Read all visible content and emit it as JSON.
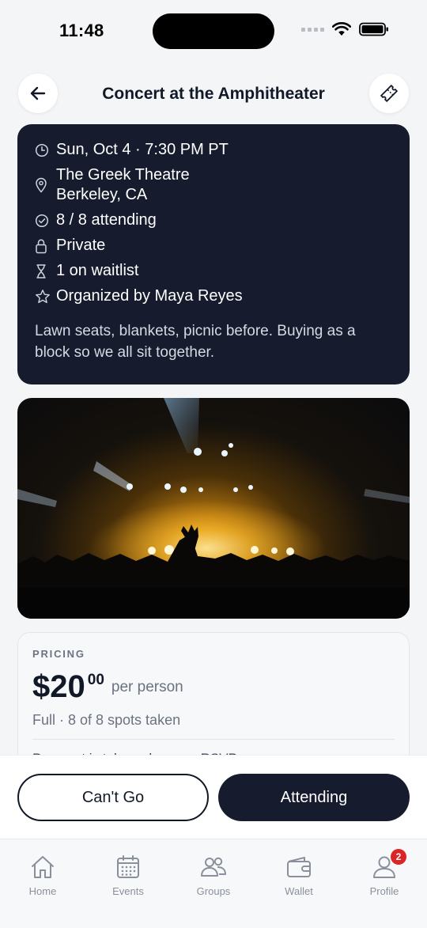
{
  "status_bar": {
    "time": "11:48"
  },
  "header": {
    "title": "Concert at the Amphitheater"
  },
  "event": {
    "rows": [
      {
        "icon": "clock-icon",
        "text": "Sun, Oct 4 · 7:30 PM PT"
      },
      {
        "icon": "location-pin-icon",
        "text": "The Greek Theatre\nBerkeley, CA"
      },
      {
        "icon": "check-circle-icon",
        "text": "8 / 8 attending"
      },
      {
        "icon": "lock-icon",
        "text": "Private"
      },
      {
        "icon": "hourglass-icon",
        "text": "1 on waitlist"
      },
      {
        "icon": "star-icon",
        "text": "Organized by Maya Reyes"
      }
    ],
    "description": "Lawn seats, blankets, picnic before. Buying as a block so we all sit together."
  },
  "pricing": {
    "label": "PRICING",
    "price_dollars": "$20",
    "price_cents": "00",
    "per": "per person",
    "status": "Full · 8 of 8 spots taken",
    "note": "Payment is taken when you RSVP"
  },
  "actions": {
    "cant_go": "Can't Go",
    "attending": "Attending"
  },
  "tabs": [
    {
      "label": "Home",
      "icon": "home-icon"
    },
    {
      "label": "Events",
      "icon": "calendar-icon"
    },
    {
      "label": "Groups",
      "icon": "groups-icon"
    },
    {
      "label": "Wallet",
      "icon": "wallet-icon"
    },
    {
      "label": "Profile",
      "icon": "profile-icon",
      "badge": "2"
    }
  ],
  "colors": {
    "card_dark": "#161b2e",
    "badge": "#dc2626",
    "background": "#f4f5f7"
  }
}
